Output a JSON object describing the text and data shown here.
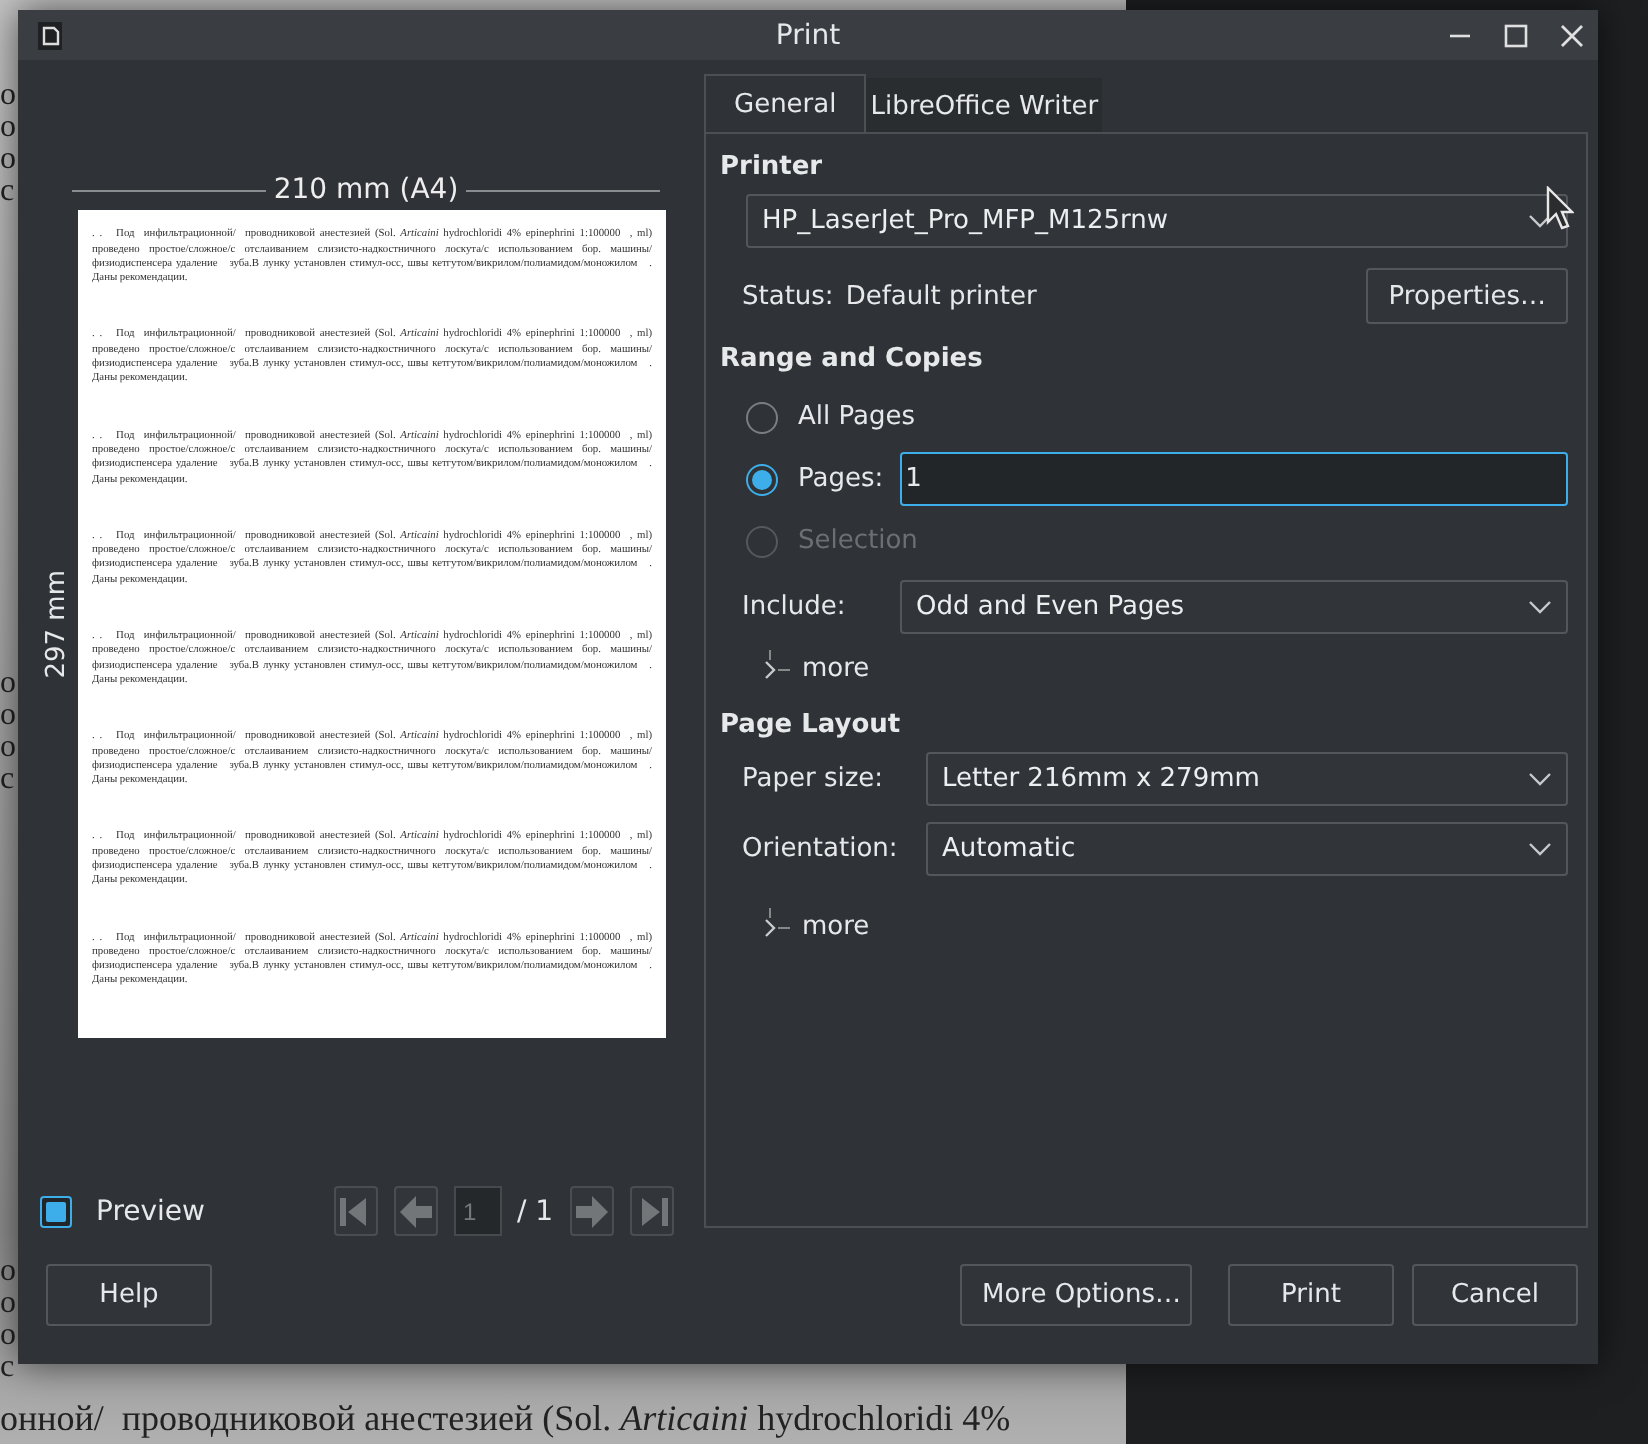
{
  "background_document": {
    "left_fragments": [
      [
        "о",
        "о",
        "о",
        "с"
      ],
      [
        "о",
        "о",
        "о",
        "с"
      ],
      [
        "о",
        "о",
        "о",
        "с"
      ]
    ],
    "bottom_line": "онной/  проводниковой анестезией (Sol. *Articaini* hydrochloridi 4%"
  },
  "window": {
    "title": "Print"
  },
  "preview": {
    "width_label": "210 mm (A4)",
    "height_label": "297 mm",
    "page_paragraphs": [
      ". .   Под  инфильтрационной/  проводниковой анестезией (Sol. *Articaini* hydrochloridi 4% epinephrini 1:100000  , ml) проведено простое/сложное/с отслаиванием слизисто-надкостничного лоскута/с использованием бор. машины/физиодиспенсера удаление   зуба.В лунку установлен стимул-осс, швы кетгутом/викрилом/полиамидом/моножилом   . Даны рекомендации.",
      ". .   Под  инфильтрационной/  проводниковой анестезией (Sol. *Articaini* hydrochloridi 4% epinephrini 1:100000  , ml) проведено простое/сложное/с отслаиванием слизисто-надкостничного лоскута/с использованием бор. машины/физиодиспенсера удаление   зуба.В лунку установлен стимул-осс, швы кетгутом/викрилом/полиамидом/моножилом   . Даны рекомендации.",
      ". .   Под  инфильтрационной/  проводниковой анестезией (Sol. *Articaini* hydrochloridi 4% epinephrini 1:100000  , ml) проведено простое/сложное/с отслаиванием слизисто-надкостничного лоскута/с использованием бор. машины/физиодиспенсера удаление   зуба.В лунку установлен стимул-осс, швы кетгутом/викрилом/полиамидом/моножилом   . Даны рекомендации.",
      ". .   Под  инфильтрационной/  проводниковой анестезией (Sol. *Articaini* hydrochloridi 4% epinephrini 1:100000  , ml) проведено простое/сложное/с отслаиванием слизисто-надкостничного лоскута/с использованием бор. машины/физиодиспенсера удаление   зуба.В лунку установлен стимул-осс, швы кетгутом/викрилом/полиамидом/моножилом   . Даны рекомендации.",
      ". .   Под  инфильтрационной/  проводниковой анестезией (Sol. *Articaini* hydrochloridi 4% epinephrini 1:100000  , ml) проведено простое/сложное/с отслаиванием слизисто-надкостничного лоскута/с использованием бор. машины/физиодиспенсера удаление   зуба.В лунку установлен стимул-осс, швы кетгутом/викрилом/полиамидом/моножилом   . Даны рекомендации.",
      ". .   Под  инфильтрационной/  проводниковой анестезией (Sol. *Articaini* hydrochloridi 4% epinephrini 1:100000  , ml) проведено простое/сложное/с отслаиванием слизисто-надкостничного лоскута/с использованием бор. машины/физиодиспенсера удаление   зуба.В лунку установлен стимул-осс, швы кетгутом/викрилом/полиамидом/моножилом   . Даны рекомендации.",
      ". .   Под  инфильтрационной/  проводниковой анестезией (Sol. *Articaini* hydrochloridi 4% epinephrini 1:100000  , ml) проведено простое/сложное/с отслаиванием слизисто-надкостничного лоскута/с использованием бор. машины/физиодиспенсера удаление   зуба.В лунку установлен стимул-осс, швы кетгутом/викрилом/полиамидом/моножилом   . Даны рекомендации.",
      ". .   Под  инфильтрационной/  проводниковой анестезией (Sol. *Articaini* hydrochloridi 4% epinephrini 1:100000  , ml) проведено простое/сложное/с отслаиванием слизисто-надкостничного лоскута/с использованием бор. машины/физиодиспенсера удаление   зуба.В лунку установлен стимул-осс, швы кетгутом/викрилом/полиамидом/моножилом   . Даны рекомендации."
    ],
    "preview_checkbox": {
      "label": "Preview",
      "checked": true
    },
    "navigation": {
      "disabled": true,
      "page": "1",
      "total": "/ 1"
    }
  },
  "tabs": [
    {
      "label": "General",
      "selected": true
    },
    {
      "label": "LibreOffice Writer",
      "selected": false
    }
  ],
  "printer": {
    "heading": "Printer",
    "device": "HP_LaserJet_Pro_MFP_M125rnw",
    "status_label": "Status:",
    "status": "Default printer",
    "properties_button": "Properties…"
  },
  "range": {
    "heading": "Range and Copies",
    "options": [
      {
        "label": "All Pages",
        "selected": false,
        "disabled": false
      },
      {
        "label": "Pages:",
        "selected": true,
        "disabled": false,
        "value": "1"
      },
      {
        "label": "Selection",
        "selected": false,
        "disabled": true
      }
    ],
    "include": {
      "label": "Include:",
      "value": "Odd and Even Pages"
    },
    "more": {
      "label": "more",
      "expanded": false
    }
  },
  "layout": {
    "heading": "Page Layout",
    "fields": [
      {
        "label": "Paper size:",
        "value": "Letter 216mm x 279mm"
      },
      {
        "label": "Orientation:",
        "value": "Automatic"
      }
    ],
    "more": {
      "label": "more",
      "expanded": false
    }
  },
  "buttons": [
    {
      "label": "Help",
      "kind": "help"
    },
    {
      "label": "More Options…",
      "kind": "action"
    },
    {
      "label": "Print",
      "kind": "action"
    },
    {
      "label": "Cancel",
      "kind": "action"
    }
  ]
}
